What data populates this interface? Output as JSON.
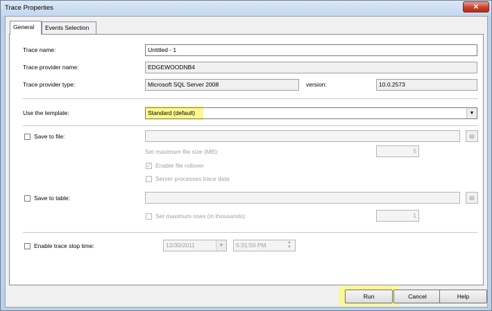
{
  "window": {
    "title": "Trace Properties",
    "close_glyph": "✕"
  },
  "tabs": [
    {
      "label": "General",
      "active": true
    },
    {
      "label": "Events Selection",
      "active": false
    }
  ],
  "general": {
    "trace_name": {
      "label": "Trace name:",
      "value": "Untitled - 1"
    },
    "trace_provider_name": {
      "label": "Trace provider name:",
      "value": "EDGEWOODNB4"
    },
    "trace_provider_type": {
      "label": "Trace provider type:",
      "value": "Microsoft SQL Server 2008",
      "version_label": "version:",
      "version_value": "10.0.2573"
    },
    "template": {
      "label": "Use the template:",
      "selected": "Standard (default)"
    },
    "save_to_file": {
      "label": "Save to file:",
      "checked": false,
      "path": "",
      "max_size_label": "Set maximum file size (MB):",
      "max_size_value": "5",
      "rollover_label": "Enable file rollover",
      "rollover_checked": true,
      "server_processes_label": "Server processes trace data",
      "server_processes_checked": false
    },
    "save_to_table": {
      "label": "Save to table:",
      "checked": false,
      "table": "",
      "max_rows_label": "Set maximum rows (in thousands):",
      "max_rows_checked": false,
      "max_rows_value": "1"
    },
    "stop_time": {
      "label": "Enable trace stop time:",
      "checked": false,
      "date": "12/30/2011",
      "time": "5:31:50 PM"
    }
  },
  "buttons": {
    "run": "Run",
    "cancel": "Cancel",
    "help": "Help"
  },
  "icons": {
    "checkbox_checked": "✓",
    "browse": "browse-icon",
    "dropdown": "▼",
    "spin_up": "▲",
    "spin_down": "▼"
  },
  "colors": {
    "highlight": "#fbf88e",
    "titlebar": "#c3d7ee",
    "close_button": "#c9412c"
  }
}
